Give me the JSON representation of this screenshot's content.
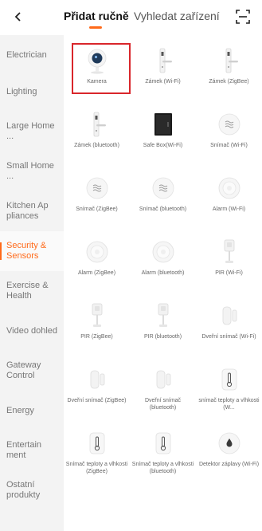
{
  "header": {
    "back_icon": "chevron-left-icon",
    "tabs": [
      {
        "label": "Přidat ručně",
        "active": true
      },
      {
        "label": "Vyhledat zařízení",
        "active": false
      }
    ],
    "scan_icon": "scan-icon",
    "accent_color": "#ff6a1a"
  },
  "sidebar": {
    "items": [
      {
        "label": "Electrician",
        "active": false
      },
      {
        "label": "Lighting",
        "active": false
      },
      {
        "label": "Large Home ...",
        "active": false
      },
      {
        "label": "Small Home ...",
        "active": false
      },
      {
        "label": "Kitchen Ap pliances",
        "active": false
      },
      {
        "label": "Security & Sensors",
        "active": true
      },
      {
        "label": "Exercise & Health",
        "active": false
      },
      {
        "label": "Video dohled",
        "active": false
      },
      {
        "label": "Gateway Control",
        "active": false
      },
      {
        "label": "Energy",
        "active": false
      },
      {
        "label": "Entertain ment",
        "active": false
      },
      {
        "label": "Ostatní produkty",
        "active": false
      }
    ]
  },
  "devices": [
    {
      "label": "Kamera",
      "icon": "camera-icon",
      "selected": true
    },
    {
      "label": "Zámek (Wi-Fi)",
      "icon": "door-lock-icon"
    },
    {
      "label": "Zámek (ZigBee)",
      "icon": "door-lock-icon"
    },
    {
      "label": "Zámek (bluetooth)",
      "icon": "door-lock-icon"
    },
    {
      "label": "Safe Box(Wi-Fi)",
      "icon": "safe-box-icon"
    },
    {
      "label": "Snímač (Wi-Fi)",
      "icon": "sensor-disc-icon"
    },
    {
      "label": "Snímač (ZigBee)",
      "icon": "sensor-disc-icon"
    },
    {
      "label": "Snímač (bluetooth)",
      "icon": "sensor-disc-icon"
    },
    {
      "label": "Alarm (Wi-Fi)",
      "icon": "alarm-icon"
    },
    {
      "label": "Alarm (ZigBee)",
      "icon": "alarm-icon"
    },
    {
      "label": "Alarm (bluetooth)",
      "icon": "alarm-icon"
    },
    {
      "label": "PIR (Wi-Fi)",
      "icon": "pir-sensor-icon"
    },
    {
      "label": "PIR (ZigBee)",
      "icon": "pir-sensor-icon"
    },
    {
      "label": "PIR (bluetooth)",
      "icon": "pir-sensor-icon"
    },
    {
      "label": "Dveřní snímač (Wi-Fi)",
      "icon": "door-sensor-icon"
    },
    {
      "label": "Dveřní snímač (ZigBee)",
      "icon": "door-sensor-icon"
    },
    {
      "label": "Dveřní snímač (bluetooth)",
      "icon": "door-sensor-icon"
    },
    {
      "label": "snímač teploty a vlhkosti (W...",
      "icon": "thermometer-icon"
    },
    {
      "label": "Snímač teploty a vlhkosti (ZigBee)",
      "icon": "thermometer-icon"
    },
    {
      "label": "Snímač teploty a vlhkosti (bluetooth)",
      "icon": "thermometer-icon"
    },
    {
      "label": "Detektor záplavy (Wi-Fi)",
      "icon": "water-leak-icon"
    }
  ]
}
